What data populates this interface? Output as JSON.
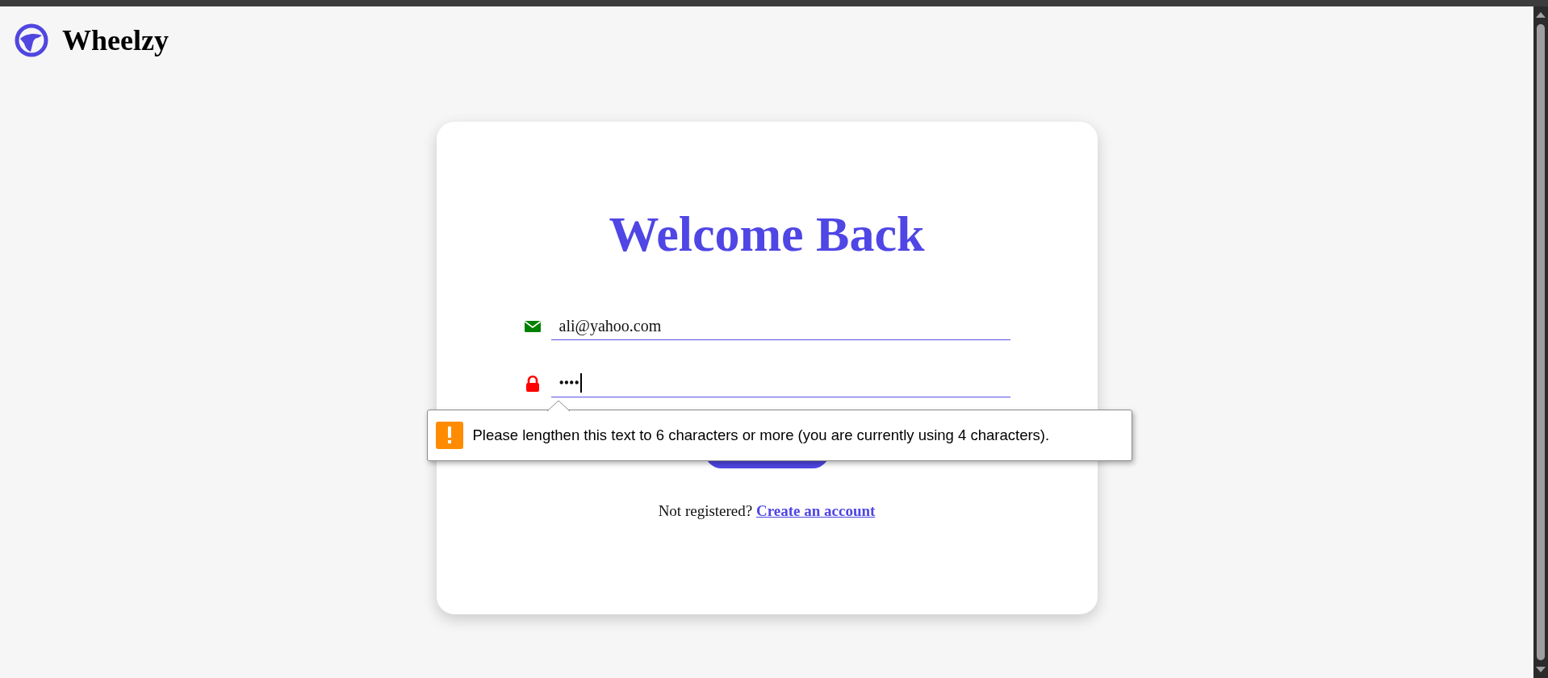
{
  "brand": {
    "name": "Wheelzy"
  },
  "card": {
    "title": "Welcome Back",
    "fields": [
      {
        "kind": "email",
        "value": "ali@yahoo.com",
        "focused": false
      },
      {
        "kind": "password",
        "value": "••••",
        "focused": true
      }
    ],
    "validation_tooltip": {
      "message": "Please lengthen this text to 6 characters or more (you are currently using 4 characters)."
    },
    "footer": {
      "text": "Not registered?",
      "link": "Create an account"
    }
  }
}
